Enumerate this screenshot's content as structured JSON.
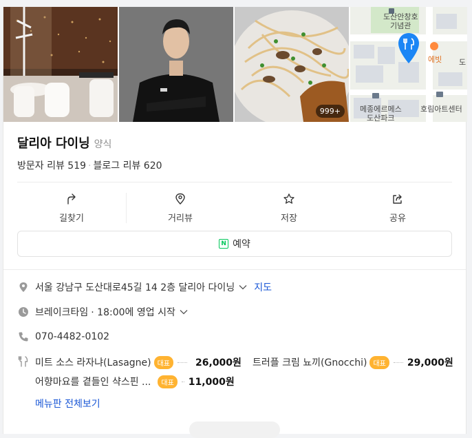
{
  "gallery": {
    "map_labels": [
      "도산안창호",
      "기념관",
      "에빗",
      "메종에르메스",
      "도산파크",
      "호림아트센터",
      "도"
    ],
    "photo_count": "999+"
  },
  "place": {
    "name": "달리아 다이닝",
    "category": "양식"
  },
  "reviews": {
    "visitor": "방문자 리뷰 519",
    "separator": "·",
    "blog": "블로그 리뷰 620"
  },
  "actions": [
    {
      "label": "길찾기",
      "icon": "directions-icon"
    },
    {
      "label": "거리뷰",
      "icon": "location-pin-icon"
    },
    {
      "label": "저장",
      "icon": "star-icon"
    },
    {
      "label": "공유",
      "icon": "share-icon"
    }
  ],
  "reserve": {
    "badge": "N",
    "label": "예약"
  },
  "info": {
    "address": "서울 강남구 도산대로45길 14 2층 달리아 다이닝",
    "map_link": "지도",
    "hours_status": "브레이크타임",
    "hours_detail": "· 18:00에 영업 시작",
    "phone": "070-4482-0102"
  },
  "menu": {
    "items": [
      {
        "name": "미트 소스 라자냐(Lasagne)",
        "tag": "대표",
        "price": "26,000원"
      },
      {
        "name": "트러플 크림 뇨끼(Gnocchi)",
        "tag": "대표",
        "price": "29,000원"
      },
      {
        "name": "어향마요를 곁들인 샥스핀 ...",
        "tag": "대표",
        "price": "11,000원"
      }
    ],
    "view_all": "메뉴판 전체보기"
  },
  "colors": {
    "link": "#1a57d6",
    "tag": "#ffb331",
    "map_pin": "#1b86f5",
    "naver_green": "#03c75a"
  }
}
